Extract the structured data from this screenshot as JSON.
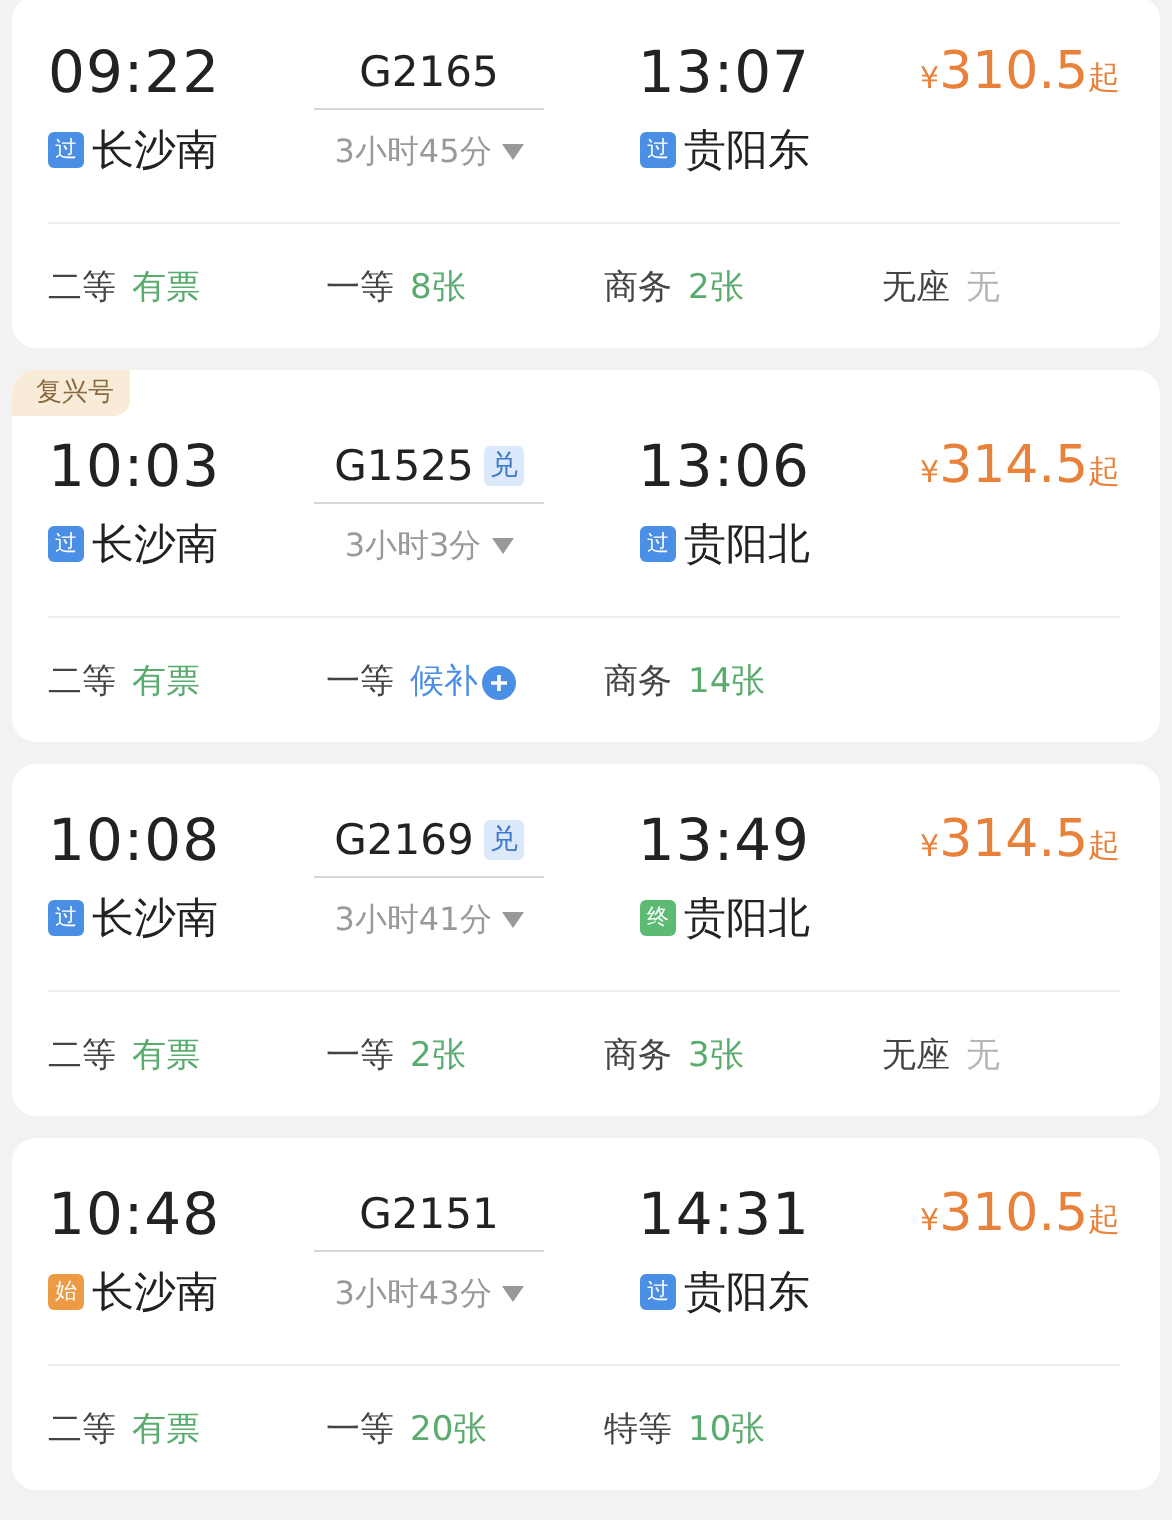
{
  "trains": [
    {
      "depart_time": "09:22",
      "depart_tag": {
        "kind": "pass",
        "text": "过"
      },
      "depart_station": "长沙南",
      "train_no": "G2165",
      "duration": "3小时45分",
      "arrive_time": "13:07",
      "arrive_tag": {
        "kind": "pass",
        "text": "过"
      },
      "arrive_station": "贵阳东",
      "price": {
        "currency": "¥",
        "amount": "310.5",
        "suffix": "起"
      },
      "seats": [
        {
          "label": "二等",
          "value": "有票",
          "kind": "available"
        },
        {
          "label": "一等",
          "value": "8张",
          "kind": "available"
        },
        {
          "label": "商务",
          "value": "2张",
          "kind": "available"
        },
        {
          "label": "无座",
          "value": "无",
          "kind": "none"
        }
      ]
    },
    {
      "badge": "复兴号",
      "depart_time": "10:03",
      "depart_tag": {
        "kind": "pass",
        "text": "过"
      },
      "depart_station": "长沙南",
      "train_no": "G1525",
      "redeem_tag": "兑",
      "duration": "3小时3分",
      "arrive_time": "13:06",
      "arrive_tag": {
        "kind": "pass",
        "text": "过"
      },
      "arrive_station": "贵阳北",
      "price": {
        "currency": "¥",
        "amount": "314.5",
        "suffix": "起"
      },
      "seats": [
        {
          "label": "二等",
          "value": "有票",
          "kind": "available"
        },
        {
          "label": "一等",
          "value": "候补",
          "kind": "waitlist"
        },
        {
          "label": "商务",
          "value": "14张",
          "kind": "available"
        }
      ]
    },
    {
      "depart_time": "10:08",
      "depart_tag": {
        "kind": "pass",
        "text": "过"
      },
      "depart_station": "长沙南",
      "train_no": "G2169",
      "redeem_tag": "兑",
      "duration": "3小时41分",
      "arrive_time": "13:49",
      "arrive_tag": {
        "kind": "end",
        "text": "终"
      },
      "arrive_station": "贵阳北",
      "price": {
        "currency": "¥",
        "amount": "314.5",
        "suffix": "起"
      },
      "seats": [
        {
          "label": "二等",
          "value": "有票",
          "kind": "available"
        },
        {
          "label": "一等",
          "value": "2张",
          "kind": "available"
        },
        {
          "label": "商务",
          "value": "3张",
          "kind": "available"
        },
        {
          "label": "无座",
          "value": "无",
          "kind": "none"
        }
      ]
    },
    {
      "depart_time": "10:48",
      "depart_tag": {
        "kind": "start",
        "text": "始"
      },
      "depart_station": "长沙南",
      "train_no": "G2151",
      "duration": "3小时43分",
      "arrive_time": "14:31",
      "arrive_tag": {
        "kind": "pass",
        "text": "过"
      },
      "arrive_station": "贵阳东",
      "price": {
        "currency": "¥",
        "amount": "310.5",
        "suffix": "起"
      },
      "seats": [
        {
          "label": "二等",
          "value": "有票",
          "kind": "available"
        },
        {
          "label": "一等",
          "value": "20张",
          "kind": "available"
        },
        {
          "label": "特等",
          "value": "10张",
          "kind": "available"
        }
      ]
    }
  ]
}
